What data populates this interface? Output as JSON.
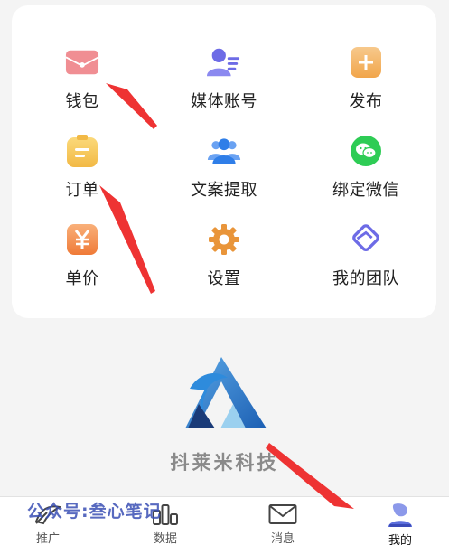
{
  "menu": {
    "items": [
      {
        "label": "钱包",
        "icon": "wallet-icon"
      },
      {
        "label": "媒体账号",
        "icon": "media-account-icon"
      },
      {
        "label": "发布",
        "icon": "publish-plus-icon"
      },
      {
        "label": "订单",
        "icon": "order-clipboard-icon"
      },
      {
        "label": "文案提取",
        "icon": "users-group-icon"
      },
      {
        "label": "绑定微信",
        "icon": "wechat-icon"
      },
      {
        "label": "单价",
        "icon": "yuan-price-icon"
      },
      {
        "label": "设置",
        "icon": "gear-icon"
      },
      {
        "label": "我的团队",
        "icon": "handshake-icon"
      }
    ]
  },
  "brand": {
    "name": "抖莱米科技"
  },
  "watermark": {
    "text": "公众号:叁心笔记"
  },
  "tabbar": {
    "items": [
      {
        "label": "推广",
        "icon": "promote-icon"
      },
      {
        "label": "数据",
        "icon": "data-bars-icon"
      },
      {
        "label": "消息",
        "icon": "envelope-icon"
      },
      {
        "label": "我的",
        "icon": "profile-icon",
        "active": true
      }
    ]
  },
  "colors": {
    "annotation_arrow": "#ee3333",
    "card_bg": "#ffffff",
    "page_bg": "#f4f4f4",
    "watermark": "#3a4fb5"
  }
}
